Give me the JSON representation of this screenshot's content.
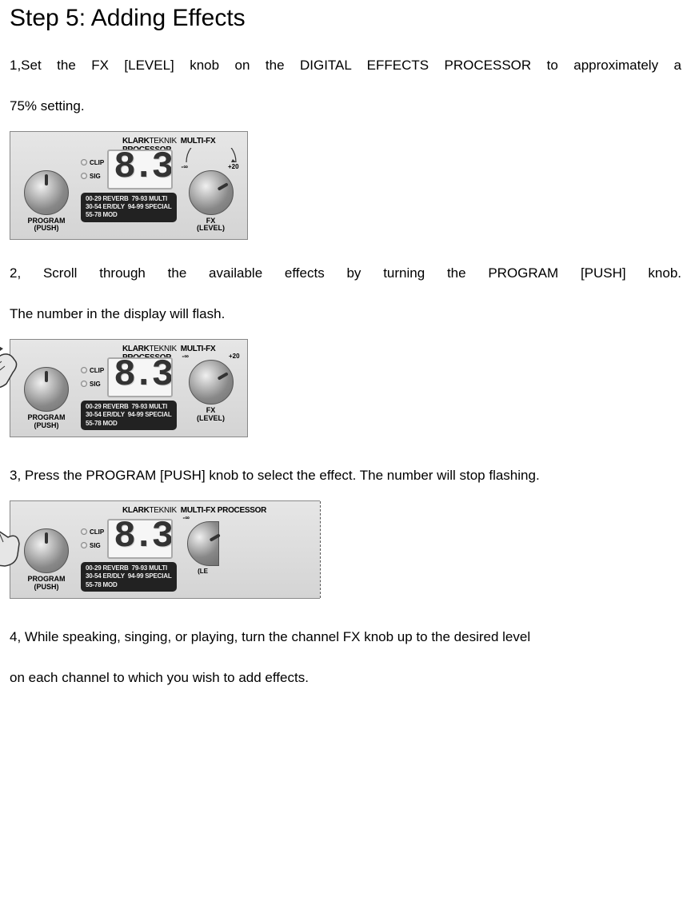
{
  "heading": "Step 5: Adding Effects",
  "step1_line1": "1,Set the FX [LEVEL] knob on the DIGITAL EFFECTS PROCESSOR to approximately a",
  "step1_line2": "75% setting.",
  "step2_line1": "2, Scroll through the available effects by turning the PROGRAM [PUSH] knob.",
  "step2_line2": "The number in the display will flash.",
  "step3": "3, Press the PROGRAM [PUSH] knob to select the effect. The number will stop flashing.",
  "step4_line1": "4, While speaking, singing, or playing, turn the channel FX knob up to the desired level",
  "step4_line2": "on each channel to which you wish to add effects.",
  "panel": {
    "brand_prefix": "KLARK",
    "brand_suffix": "TEKNIK",
    "brand_sub": "MULTI-FX PROCESSOR",
    "program_label": "PROGRAM",
    "program_sub": "(PUSH)",
    "clip": "CLIP",
    "sig": "SIG",
    "display_value": "8.3.",
    "legend_line1": "00-29 REVERB  79-93 MULTI",
    "legend_line2": "30-54 ER/DLY  94-99 SPECIAL",
    "legend_line3": "55-78 MOD",
    "fx_neg": "-∞",
    "fx_pos": "+20",
    "fx_label": "FX",
    "fx_sub": "(LEVEL)"
  }
}
